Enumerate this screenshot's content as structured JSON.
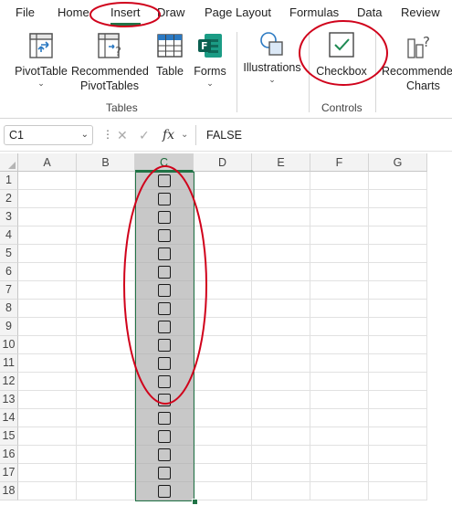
{
  "menu": {
    "tabs": [
      {
        "label": "File"
      },
      {
        "label": "Home"
      },
      {
        "label": "Insert"
      },
      {
        "label": "Draw"
      },
      {
        "label": "Page Layout"
      },
      {
        "label": "Formulas"
      },
      {
        "label": "Data"
      },
      {
        "label": "Review"
      }
    ],
    "active_tab": "Insert"
  },
  "ribbon": {
    "tables_group": {
      "label": "Tables",
      "pivottable": {
        "label": "PivotTable",
        "icon": "pivottable-icon"
      },
      "recommended_pivottables": {
        "line1": "Recommended",
        "line2": "PivotTables",
        "icon": "recommended-pivottables-icon"
      },
      "table": {
        "label": "Table",
        "icon": "table-icon"
      },
      "forms": {
        "label": "Forms",
        "icon": "forms-icon"
      }
    },
    "illustrations": {
      "label": "Illustrations",
      "icon": "shapes-icon"
    },
    "controls_group": {
      "label": "Controls",
      "checkbox": {
        "label": "Checkbox",
        "icon": "checkbox-icon"
      }
    },
    "charts": {
      "line1": "Recommended",
      "line2": "Charts",
      "icon": "recommended-charts-icon"
    }
  },
  "formula_bar": {
    "name_box": "C1",
    "fx_label": "fx",
    "formula": "FALSE"
  },
  "grid": {
    "columns": [
      "A",
      "B",
      "C",
      "D",
      "E",
      "F",
      "G"
    ],
    "rows": [
      "1",
      "2",
      "3",
      "4",
      "5",
      "6",
      "7",
      "8",
      "9",
      "10",
      "11",
      "12",
      "13",
      "14",
      "15",
      "16",
      "17",
      "18"
    ],
    "selected_column": "C",
    "checkbox_column": "C",
    "checkbox_values": [
      false,
      false,
      false,
      false,
      false,
      false,
      false,
      false,
      false,
      false,
      false,
      false,
      false,
      false,
      false,
      false,
      false,
      false
    ]
  },
  "colors": {
    "accent": "#217346",
    "annotation": "#d0021b",
    "selection_fill": "#c8c8c8"
  }
}
